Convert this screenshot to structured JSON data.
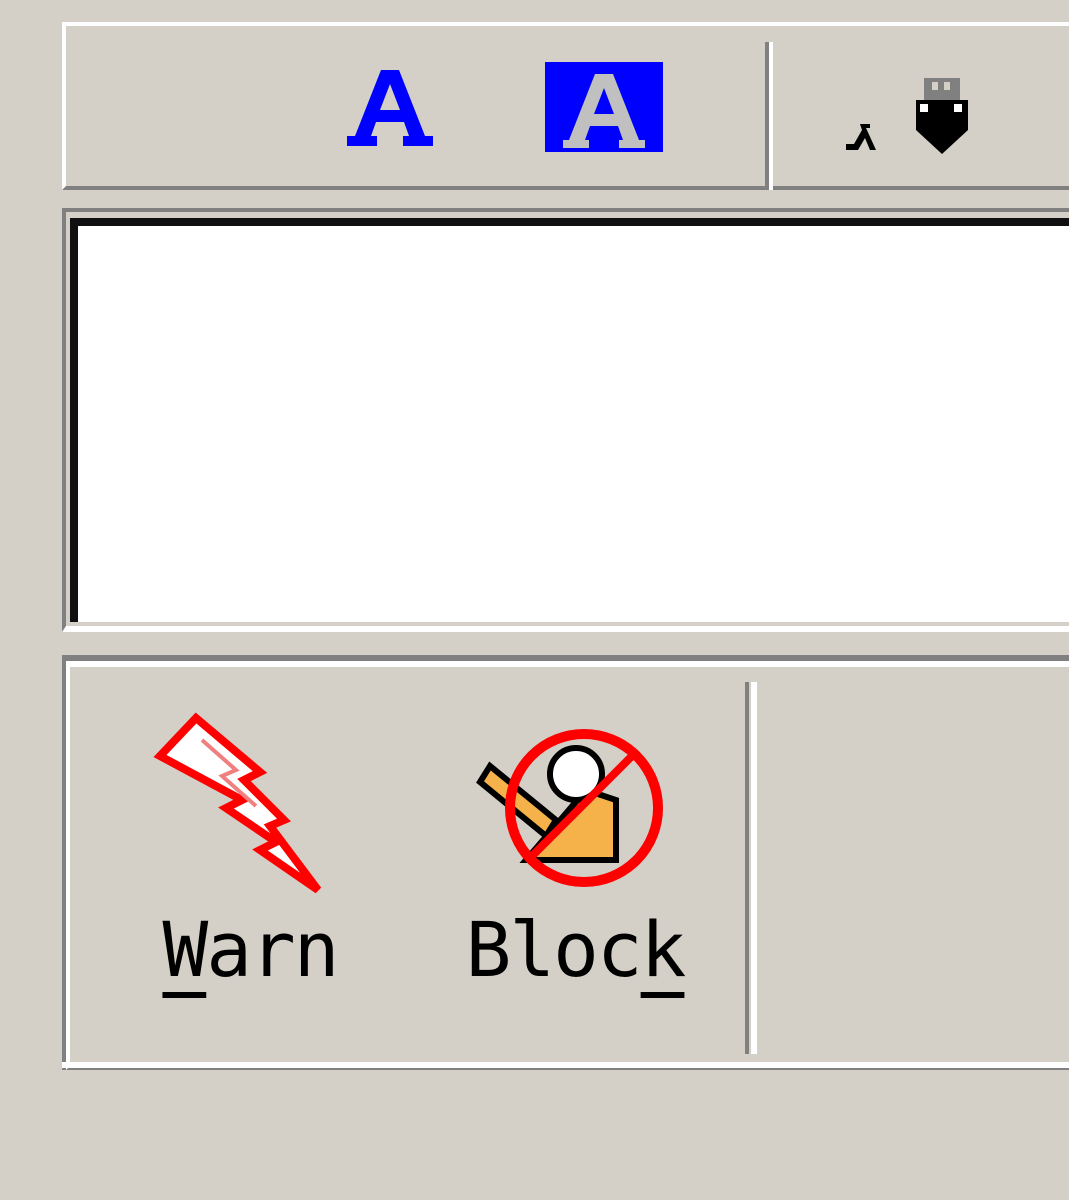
{
  "toolbar_top": {
    "icons": [
      "font-color-icon",
      "font-highlight-icon",
      "emoticon-icon"
    ],
    "colors": {
      "font_blue": "#0000ff",
      "highlight_bg": "#0000ff",
      "highlight_fg": "#c0c0c0"
    }
  },
  "message_area": {
    "value": ""
  },
  "toolbar_bottom": {
    "warn": {
      "label_prefix": "",
      "label_mnemonic": "W",
      "label_suffix": "arn",
      "icon": "lightning-bolt-icon"
    },
    "block": {
      "label_prefix": "Bloc",
      "label_mnemonic": "k",
      "label_suffix": "",
      "icon": "block-hand-icon"
    }
  },
  "colors": {
    "window_bg": "#d4d0c8",
    "shadow": "#808080",
    "highlight": "#ffffff",
    "warn_red": "#ff0000",
    "block_orange": "#f5b24a"
  }
}
